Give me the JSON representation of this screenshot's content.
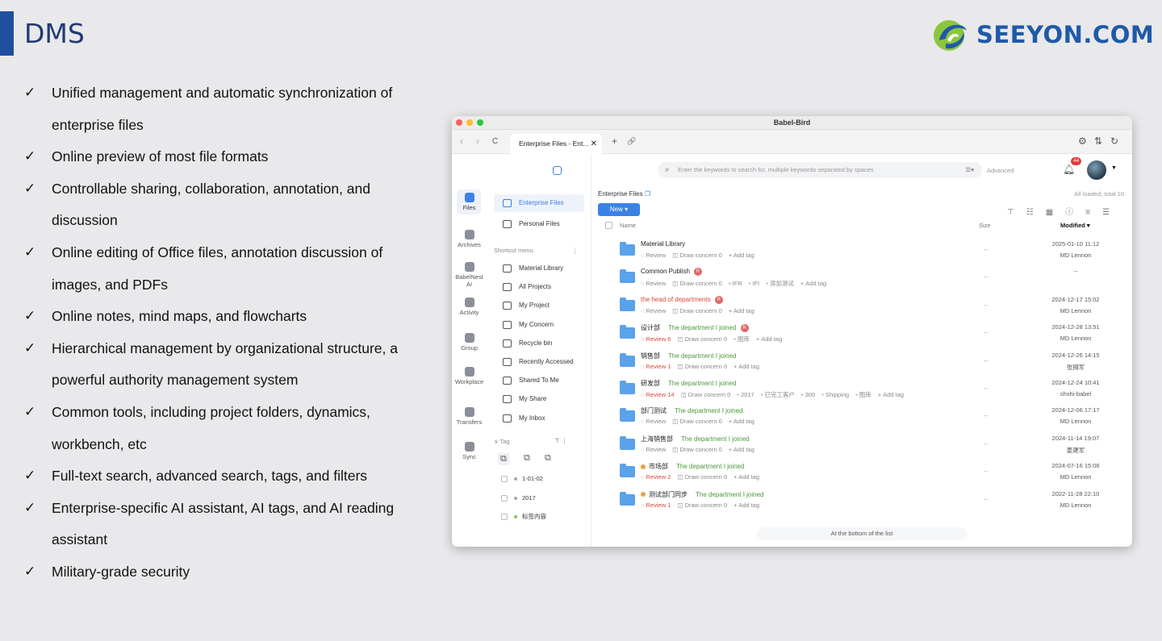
{
  "slide": {
    "title": "DMS",
    "logo_text": "SEEYON.COM",
    "accent_color": "#1f4f9e",
    "bullets": [
      "Unified management and automatic synchronization of enterprise files",
      "Online preview of most file formats",
      "Controllable sharing, collaboration, annotation, and discussion",
      "Online editing of Office files, annotation discussion of images, and PDFs",
      "Online notes, mind maps, and flowcharts",
      "Hierarchical management by organizational structure, a powerful authority management system",
      "Common tools, including project folders, dynamics, workbench, etc",
      "Full-text search, advanced search, tags, and filters",
      "Enterprise-specific AI assistant, AI tags, and AI reading assistant",
      "Military-grade security"
    ],
    "check_glyph": "✓"
  },
  "window": {
    "title": "Babel-Bird",
    "tab_label": "Enterprise Files - Ent...",
    "tab_close": "✕",
    "icons": {
      "back": "‹",
      "forward": "›",
      "reload": "C",
      "new_tab": "+",
      "link": "🔗",
      "settings": "⚙",
      "sort": "⇅",
      "refresh": "↻"
    }
  },
  "rail": [
    {
      "label": "Files",
      "icon": "folder-icon"
    },
    {
      "label": "Archives",
      "icon": "archive-icon"
    },
    {
      "label": "BabelNest AI",
      "icon": "ai-icon"
    },
    {
      "label": "Activity",
      "icon": "activity-icon"
    },
    {
      "label": "Group",
      "icon": "group-icon"
    },
    {
      "label": "Workplace",
      "icon": "workplace-icon"
    },
    {
      "label": "Transfers",
      "icon": "transfer-icon"
    },
    {
      "label": "Sync",
      "icon": "sync-icon"
    }
  ],
  "panel": {
    "enterprise_files": "Enterprise Files",
    "personal_files": "Personal Files",
    "shortcut_label": "Shortcut menu",
    "shortcuts": [
      "Material Library",
      "All Projects",
      "My Project",
      "My Concern",
      "Recycle bin",
      "Recently Accessed",
      "Shared To Me",
      "My Share",
      "My Inbox"
    ],
    "tag_label": "Tag",
    "tags": [
      "1-01-02",
      "2017",
      "标签内容"
    ]
  },
  "main": {
    "search_placeholder": "Enter the keywords to search for, multiple keywords separated by spaces",
    "advanced": "Advanced",
    "notification_count": "44",
    "breadcrumb": "Enterprise Files",
    "loaded_status": "All loaded, total 10",
    "new_button": "New ▾",
    "col_name": "Name",
    "col_size": "Size",
    "col_modified": "Modified ▾",
    "bottom_note": "At the bottom of the list",
    "rows": [
      {
        "name": "Material Library",
        "dept": "",
        "badge": "",
        "dot": false,
        "review": "Review",
        "review_red": false,
        "concern": "Draw concern 0",
        "tags": [],
        "size": "--",
        "date": "2025-01-10 11:12",
        "user": "MD Lennon"
      },
      {
        "name": "Common Publish",
        "dept": "",
        "badge": "R",
        "dot": false,
        "review": "Review",
        "review_red": false,
        "concern": "Draw concern 0",
        "tags": [
          "IFR",
          "IFI",
          "添加测试"
        ],
        "size": "--",
        "date": "--",
        "user": ""
      },
      {
        "name": "the head of departments",
        "dept": "",
        "badge": "R",
        "dot": false,
        "review": "Review",
        "review_red": false,
        "concern": "Draw concern 0",
        "tags": [],
        "size": "--",
        "date": "2024-12-17 15:02",
        "user": "MD Lennon"
      },
      {
        "name": "设计部",
        "dept": "The department I joined",
        "badge": "R",
        "dot": false,
        "review": "Review 6",
        "review_red": true,
        "concern": "Draw concern 0",
        "tags": [
          "图库"
        ],
        "size": "--",
        "date": "2024-12-28 13:51",
        "user": "MD Lennon"
      },
      {
        "name": "销售部",
        "dept": "The department I joined",
        "badge": "",
        "dot": false,
        "review": "Review 1",
        "review_red": true,
        "concern": "Draw concern 0",
        "tags": [],
        "size": "--",
        "date": "2024-12-26 14:15",
        "user": "张拥军"
      },
      {
        "name": "研发部",
        "dept": "The department I joined",
        "badge": "",
        "dot": false,
        "review": "Review 14",
        "review_red": true,
        "concern": "Draw concern 0",
        "tags": [
          "2017",
          "已完工客户",
          "300",
          "Shipping",
          "图库"
        ],
        "size": "--",
        "date": "2024-12-24 10:41",
        "user": "shshi-babel"
      },
      {
        "name": "部门测试",
        "dept": "The department I joined",
        "badge": "",
        "dot": false,
        "review": "Review",
        "review_red": false,
        "concern": "Draw concern 0",
        "tags": [],
        "size": "--",
        "date": "2024-12-06 17:17",
        "user": "MD Lennon"
      },
      {
        "name": "上海销售部",
        "dept": "The department I joined",
        "badge": "",
        "dot": false,
        "review": "Review",
        "review_red": false,
        "concern": "Draw concern 0",
        "tags": [],
        "size": "--",
        "date": "2024-11-14 19:07",
        "user": "姜建军"
      },
      {
        "name": "市场部",
        "dept": "The department I joined",
        "badge": "",
        "dot": true,
        "review": "Review 2",
        "review_red": true,
        "concern": "Draw concern 0",
        "tags": [],
        "size": "--",
        "date": "2024-07-16 15:06",
        "user": "MD Lennon"
      },
      {
        "name": "测试部门同步",
        "dept": "The department I joined",
        "badge": "",
        "dot": true,
        "review": "Review 1",
        "review_red": true,
        "concern": "Draw concern 0",
        "tags": [],
        "size": "--",
        "date": "2022-11-28 22:10",
        "user": "MD Lennon"
      }
    ],
    "add_tag": "+ Add tag"
  }
}
